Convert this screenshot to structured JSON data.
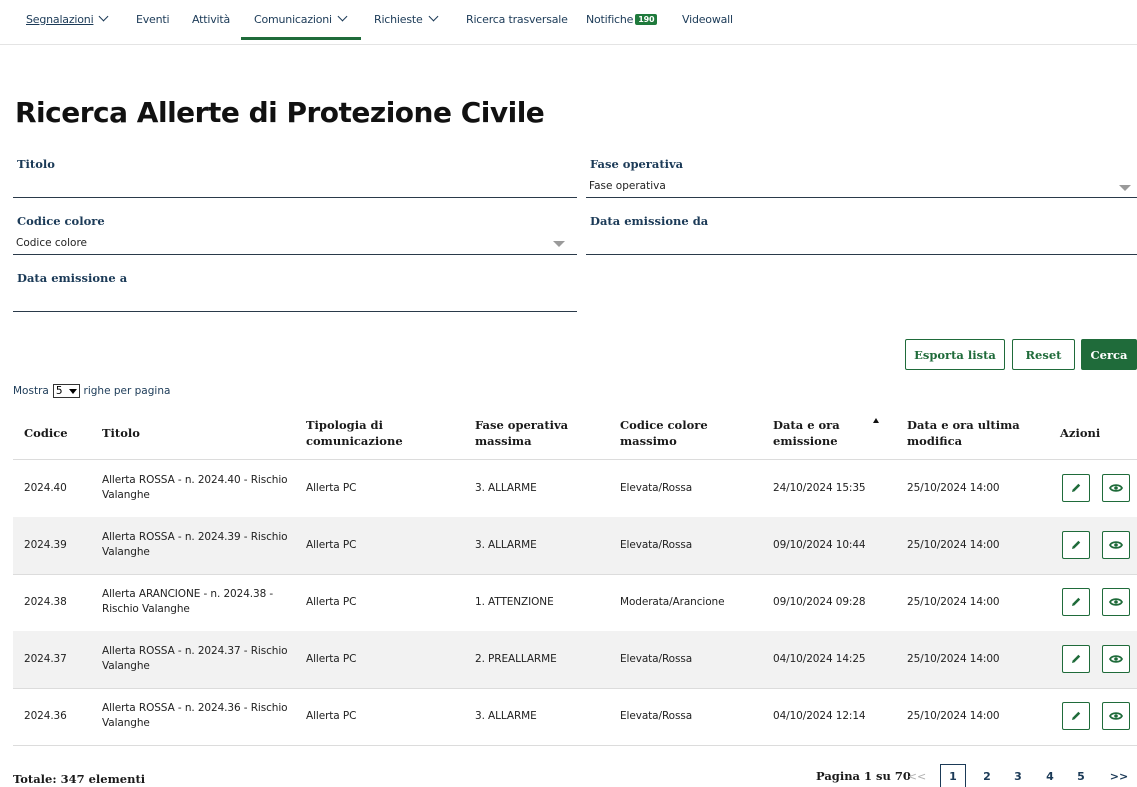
{
  "nav": {
    "items": [
      {
        "label": "Segnalazioni",
        "dropdown": true
      },
      {
        "label": "Eventi",
        "dropdown": false
      },
      {
        "label": "Attività",
        "dropdown": false
      },
      {
        "label": "Comunicazioni",
        "dropdown": true,
        "active": true
      },
      {
        "label": "Richieste",
        "dropdown": true
      },
      {
        "label": "Ricerca trasversale",
        "dropdown": false
      },
      {
        "label": "Notifiche",
        "dropdown": false,
        "badge": "190"
      },
      {
        "label": "Videowall",
        "dropdown": false
      }
    ]
  },
  "page": {
    "title": "Ricerca Allerte di Protezione Civile"
  },
  "filters": {
    "titolo": {
      "label": "Titolo",
      "value": ""
    },
    "fase": {
      "label": "Fase operativa",
      "value": "Fase operativa"
    },
    "colore": {
      "label": "Codice colore",
      "value": "Codice colore"
    },
    "data_da": {
      "label": "Data emissione da",
      "value": ""
    },
    "data_a": {
      "label": "Data emissione a",
      "value": ""
    }
  },
  "actions": {
    "esporta": "Esporta lista",
    "reset": "Reset",
    "cerca": "Cerca"
  },
  "page_size": {
    "prefix": "Mostra",
    "value": "5",
    "suffix": "righe per pagina"
  },
  "table": {
    "headers": [
      [
        "Codice"
      ],
      [
        "Titolo"
      ],
      [
        "Tipologia di",
        "comunicazione"
      ],
      [
        "Fase operativa",
        "massima"
      ],
      [
        "Codice colore",
        "massimo"
      ],
      [
        "Data e ora",
        "emissione"
      ],
      [
        "Data e ora ultima",
        "modifica"
      ],
      [
        "Azioni"
      ]
    ],
    "rows": [
      {
        "codice": "2024.40",
        "titolo": [
          "Allerta ROSSA - n. 2024.40 - Rischio",
          "Valanghe"
        ],
        "tipologia": "Allerta PC",
        "fase": "3. ALLARME",
        "colore": "Elevata/Rossa",
        "emissione": "24/10/2024 15:35",
        "modifica": "25/10/2024 14:00"
      },
      {
        "codice": "2024.39",
        "titolo": [
          "Allerta ROSSA - n. 2024.39 - Rischio",
          "Valanghe"
        ],
        "tipologia": "Allerta PC",
        "fase": "3. ALLARME",
        "colore": "Elevata/Rossa",
        "emissione": "09/10/2024 10:44",
        "modifica": "25/10/2024 14:00"
      },
      {
        "codice": "2024.38",
        "titolo": [
          "Allerta ARANCIONE - n. 2024.38 -",
          "Rischio Valanghe"
        ],
        "tipologia": "Allerta PC",
        "fase": "1. ATTENZIONE",
        "colore": "Moderata/Arancione",
        "emissione": "09/10/2024 09:28",
        "modifica": "25/10/2024 14:00"
      },
      {
        "codice": "2024.37",
        "titolo": [
          "Allerta ROSSA - n. 2024.37 - Rischio",
          "Valanghe"
        ],
        "tipologia": "Allerta PC",
        "fase": "2. PREALLARME",
        "colore": "Elevata/Rossa",
        "emissione": "04/10/2024 14:25",
        "modifica": "25/10/2024 14:00"
      },
      {
        "codice": "2024.36",
        "titolo": [
          "Allerta ROSSA - n. 2024.36 - Rischio",
          "Valanghe"
        ],
        "tipologia": "Allerta PC",
        "fase": "3. ALLARME",
        "colore": "Elevata/Rossa",
        "emissione": "04/10/2024 12:14",
        "modifica": "25/10/2024 14:00"
      }
    ]
  },
  "footer": {
    "totale": "Totale: 347 elementi",
    "pagina": "Pagina 1 su 70",
    "prev": "<<",
    "pages": [
      "1",
      "2",
      "3",
      "4",
      "5"
    ],
    "next": ">>"
  },
  "colors": {
    "accent": "#1f6b3a",
    "nav_text": "#1b3a57",
    "row_alt": "#f2f2f2"
  }
}
